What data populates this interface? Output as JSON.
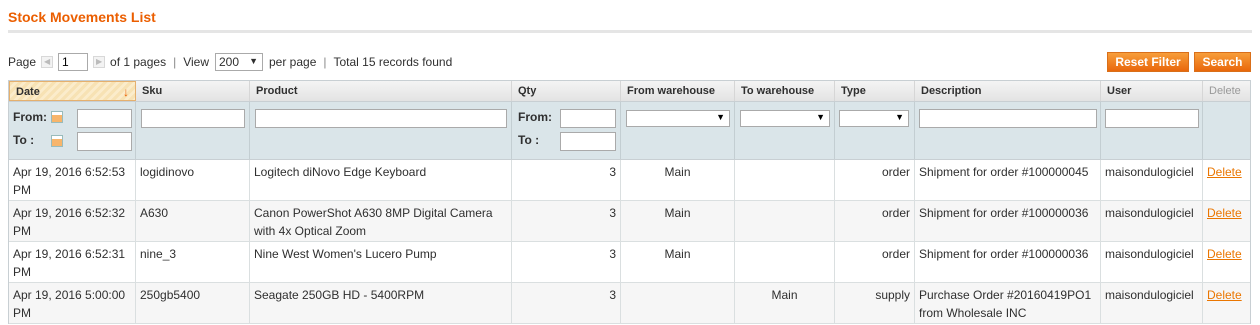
{
  "page_title": "Stock Movements List",
  "pager": {
    "page_label": "Page",
    "page_value": "1",
    "of_pages": "of 1 pages",
    "view_label": "View",
    "per_page_value": "200",
    "per_page_label": "per page",
    "total": "Total 15 records found",
    "separator": "|"
  },
  "buttons": {
    "reset_filter": "Reset Filter",
    "search": "Search"
  },
  "columns": {
    "date": "Date",
    "sku": "Sku",
    "product": "Product",
    "qty": "Qty",
    "from_warehouse": "From warehouse",
    "to_warehouse": "To warehouse",
    "type": "Type",
    "description": "Description",
    "user": "User",
    "delete": "Delete"
  },
  "filters": {
    "from_label": "From:",
    "to_label": "To :"
  },
  "sort_indicator": "↓",
  "rows": [
    {
      "date": "Apr 19, 2016 6:52:53 PM",
      "sku": "logidinovo",
      "product": "Logitech diNovo Edge Keyboard",
      "qty": "3",
      "from": "Main",
      "to": "",
      "type": "order",
      "description": "Shipment for order #100000045",
      "user": "maisondulogiciel",
      "action": "Delete"
    },
    {
      "date": "Apr 19, 2016 6:52:32 PM",
      "sku": "A630",
      "product": "Canon PowerShot A630 8MP Digital Camera with 4x Optical Zoom",
      "qty": "3",
      "from": "Main",
      "to": "",
      "type": "order",
      "description": "Shipment for order #100000036",
      "user": "maisondulogiciel",
      "action": "Delete"
    },
    {
      "date": "Apr 19, 2016 6:52:31 PM",
      "sku": "nine_3",
      "product": "Nine West Women's Lucero Pump",
      "qty": "3",
      "from": "Main",
      "to": "",
      "type": "order",
      "description": "Shipment for order #100000036",
      "user": "maisondulogiciel",
      "action": "Delete"
    },
    {
      "date": "Apr 19, 2016 5:00:00 PM",
      "sku": "250gb5400",
      "product": "Seagate 250GB HD - 5400RPM",
      "qty": "3",
      "from": "",
      "to": "Main",
      "type": "supply",
      "description": "Purchase Order #20160419PO1 from Wholesale INC",
      "user": "maisondulogiciel",
      "action": "Delete"
    }
  ],
  "colors": {
    "accent": "#eb5e00",
    "button": "#f18b2a",
    "filter_bg": "#dae5e9",
    "link": "#ea7601"
  }
}
